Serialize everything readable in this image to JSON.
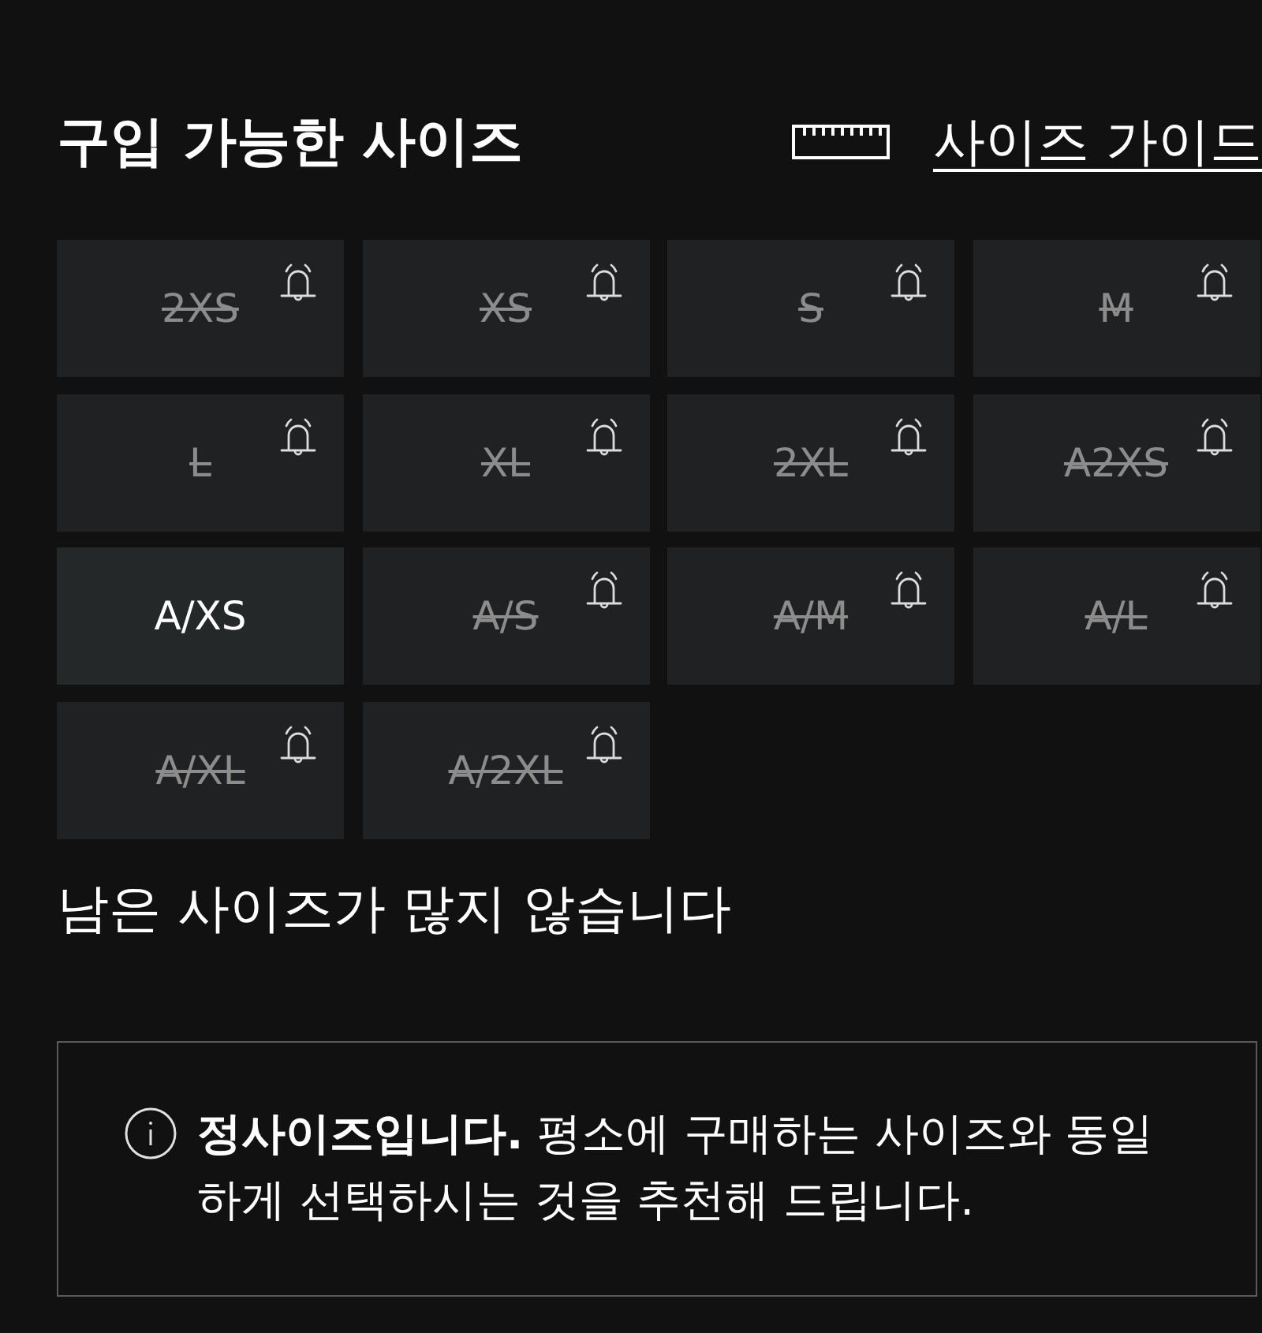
{
  "header": {
    "title": "구입 가능한 사이즈",
    "size_guide_link": "사이즈 가이드"
  },
  "sizes": [
    {
      "label": "2XS",
      "sold_out": true
    },
    {
      "label": "XS",
      "sold_out": true
    },
    {
      "label": "S",
      "sold_out": true
    },
    {
      "label": "M",
      "sold_out": true
    },
    {
      "label": "L",
      "sold_out": true
    },
    {
      "label": "XL",
      "sold_out": true
    },
    {
      "label": "2XL",
      "sold_out": true
    },
    {
      "label": "A2XS",
      "sold_out": true
    },
    {
      "label": "A/XS",
      "sold_out": false
    },
    {
      "label": "A/S",
      "sold_out": true
    },
    {
      "label": "A/M",
      "sold_out": true
    },
    {
      "label": "A/L",
      "sold_out": true
    },
    {
      "label": "A/XL",
      "sold_out": true
    },
    {
      "label": "A/2XL",
      "sold_out": true
    }
  ],
  "stock_note": "남은 사이즈가 많지 않습니다",
  "fit_notice": {
    "text": "**정사이즈입니다.** 평소에 구매하는 사이즈와 동일하게 선택하시는 것을 추천해 드립니다."
  }
}
